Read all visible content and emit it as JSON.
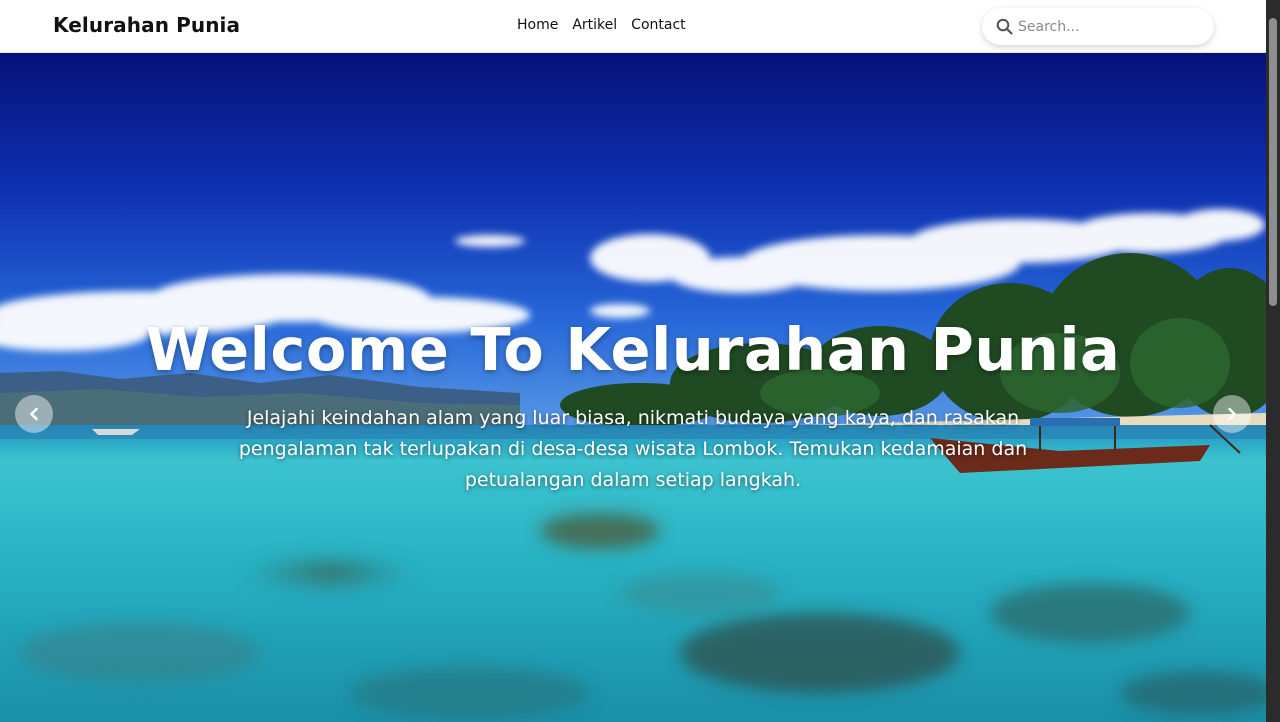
{
  "navbar": {
    "brand": "Kelurahan Punia",
    "links": [
      "Home",
      "Artikel",
      "Contact"
    ],
    "search": {
      "placeholder": "Search...",
      "value": ""
    }
  },
  "hero": {
    "title": "Welcome To Kelurahan Punia",
    "subtitle": "Jelajahi keindahan alam yang luar biasa, nikmati budaya yang kaya, dan rasakan pengalaman tak terlupakan di desa-desa wisata Lombok. Temukan kedamaian dan petualangan dalam setiap langkah."
  },
  "icons": {
    "search": "search-icon",
    "prev": "chevron-left-icon",
    "next": "chevron-right-icon"
  },
  "colors": {
    "navbar_bg": "#ffffff",
    "sky_top": "#08167a",
    "sky_mid": "#1b4fd0",
    "water": "#2bb9c9",
    "text_on_image": "#ffffff"
  }
}
